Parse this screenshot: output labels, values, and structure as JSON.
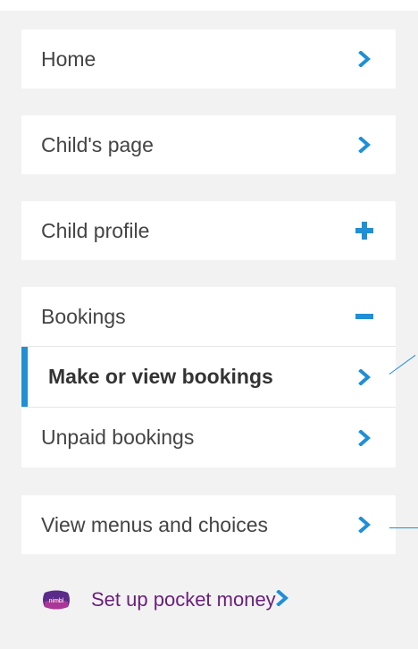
{
  "menu": {
    "home": "Home",
    "childs_page": "Child's page",
    "child_profile": "Child profile",
    "bookings": "Bookings",
    "make_or_view_bookings": "Make or view bookings",
    "unpaid_bookings": "Unpaid bookings",
    "view_menus": "View menus and choices",
    "pocket_money": "Set up pocket money"
  },
  "brand": {
    "nimbl_logo_text": "nimbl"
  },
  "colors": {
    "accent": "#1f8fd6",
    "pocket_text": "#6a1f7a",
    "nimbl_badge": "#5b2b8a"
  }
}
